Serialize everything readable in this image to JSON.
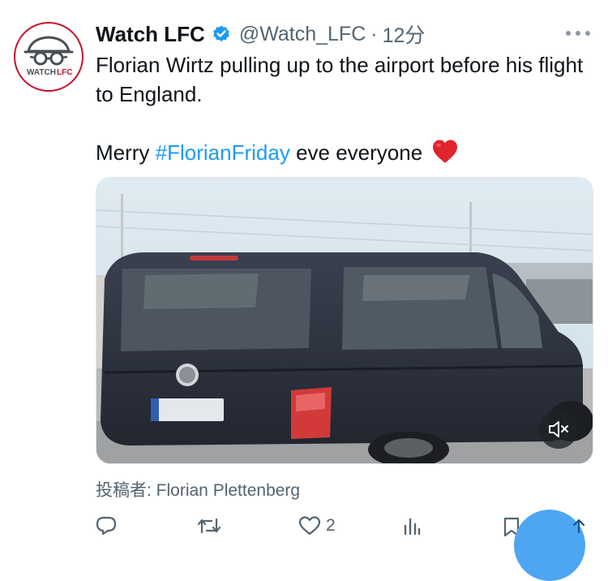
{
  "tweet": {
    "author_name": "Watch LFC",
    "handle": "@Watch_LFC",
    "separator": "·",
    "timestamp": "12分",
    "line1": "Florian Wirtz pulling up to the airport before his flight to England.",
    "line2_prefix": "Merry ",
    "hashtag": "#FlorianFriday",
    "line2_suffix": " eve everyone ",
    "credit": "投稿者: Florian Plettenberg",
    "like_count": "2"
  },
  "avatar": {
    "logo_text_watch": "WATCH",
    "logo_text_lfc": "LFC"
  },
  "icons": {
    "verified": "verified-badge-icon",
    "more": "more-horizontal-icon",
    "heart_emoji": "red-heart-emoji",
    "mute": "volume-muted-icon",
    "reply": "reply-icon",
    "retweet": "retweet-icon",
    "like": "like-heart-icon",
    "analytics": "analytics-icon",
    "bookmark": "bookmark-icon",
    "share": "share-icon"
  },
  "colors": {
    "link_blue": "#1d9bf0",
    "verified_blue": "#1d9bf0",
    "secondary_text": "#536471",
    "brand_red": "#c8102e",
    "heart_red": "#e0242e",
    "fab_blue": "#4ea6f2"
  }
}
